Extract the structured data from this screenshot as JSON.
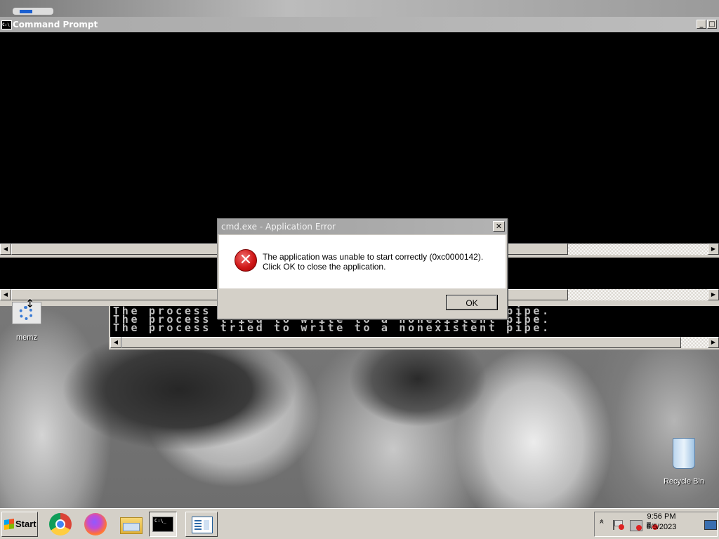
{
  "cmd_window": {
    "title": "Command Prompt",
    "minimize": "_",
    "maximize": "□"
  },
  "console_lines": [
    "The process tried to write to a nonexistent pipe.",
    "The process tried to write to a nonexistent pipe.",
    "The process tried to write to a nonexistent pipe."
  ],
  "scroll": {
    "left": "◀",
    "right": "▶"
  },
  "dialog": {
    "title": "cmd.exe - Application Error",
    "close": "✕",
    "icon_glyph": "✕",
    "message": "The application was unable to start correctly (0xc0000142). Click OK to close the application.",
    "ok_label": "OK"
  },
  "desktop_icons": {
    "memz": "memz",
    "recycle_bin": "Recycle Bin"
  },
  "taskbar": {
    "start_label": "Start",
    "apps": [
      "chrome-icon",
      "firefox-icon",
      "file-explorer-icon",
      "command-prompt-icon",
      "notepad-icon"
    ],
    "tray": {
      "chevron": "»",
      "time": "9:56 PM",
      "date": "6/5/2023"
    }
  }
}
